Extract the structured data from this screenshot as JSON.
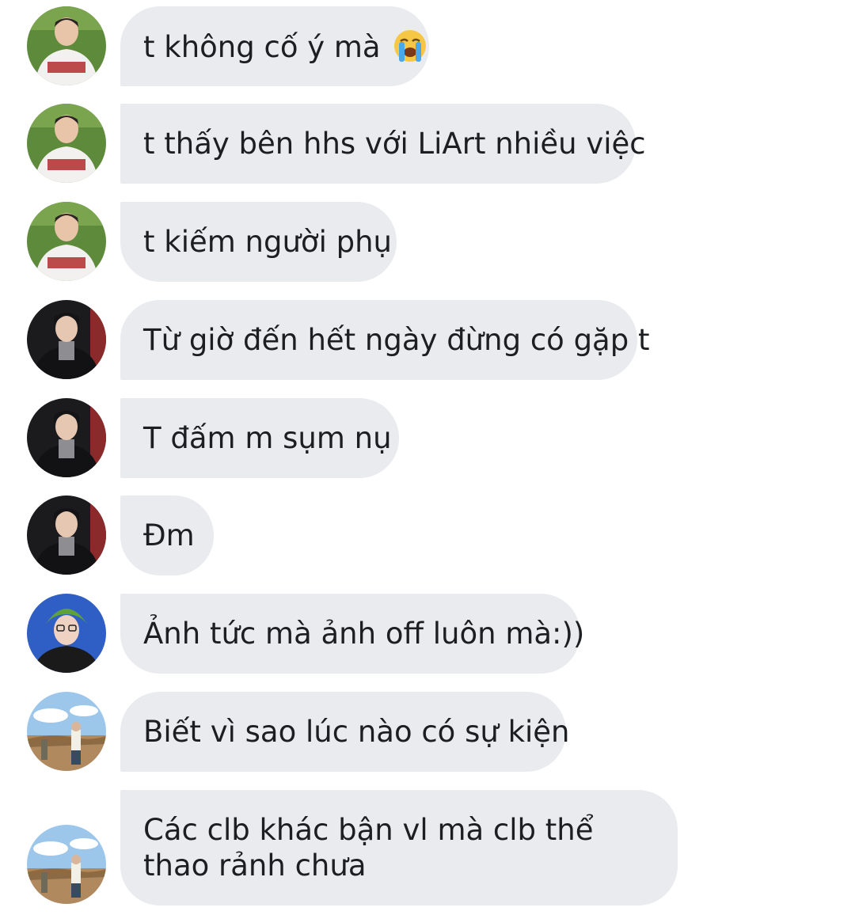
{
  "messages": [
    {
      "text": "t không cố ý mà",
      "emoji": "loudly-crying-face",
      "sender": "user-a"
    },
    {
      "text": "t thấy bên hhs với LiArt nhiều việc",
      "sender": "user-a"
    },
    {
      "text": "t kiếm người phụ",
      "sender": "user-a"
    },
    {
      "text": "Từ giờ đến hết ngày đừng có gặp t",
      "sender": "user-b"
    },
    {
      "text": "T đấm m sụm nụ",
      "sender": "user-b"
    },
    {
      "text": "Đm",
      "sender": "user-b"
    },
    {
      "text": "Ảnh tức mà ảnh off luôn mà:))",
      "sender": "user-c"
    },
    {
      "text": "Biết vì sao lúc nào có sự kiện",
      "sender": "user-d"
    },
    {
      "text": "Các clb khác bận vl mà clb thể thao rảnh chưa",
      "sender": "user-d"
    }
  ],
  "colors": {
    "bubble_bg": "#e9ebee",
    "text": "#1c1e21",
    "background": "#ffffff"
  }
}
